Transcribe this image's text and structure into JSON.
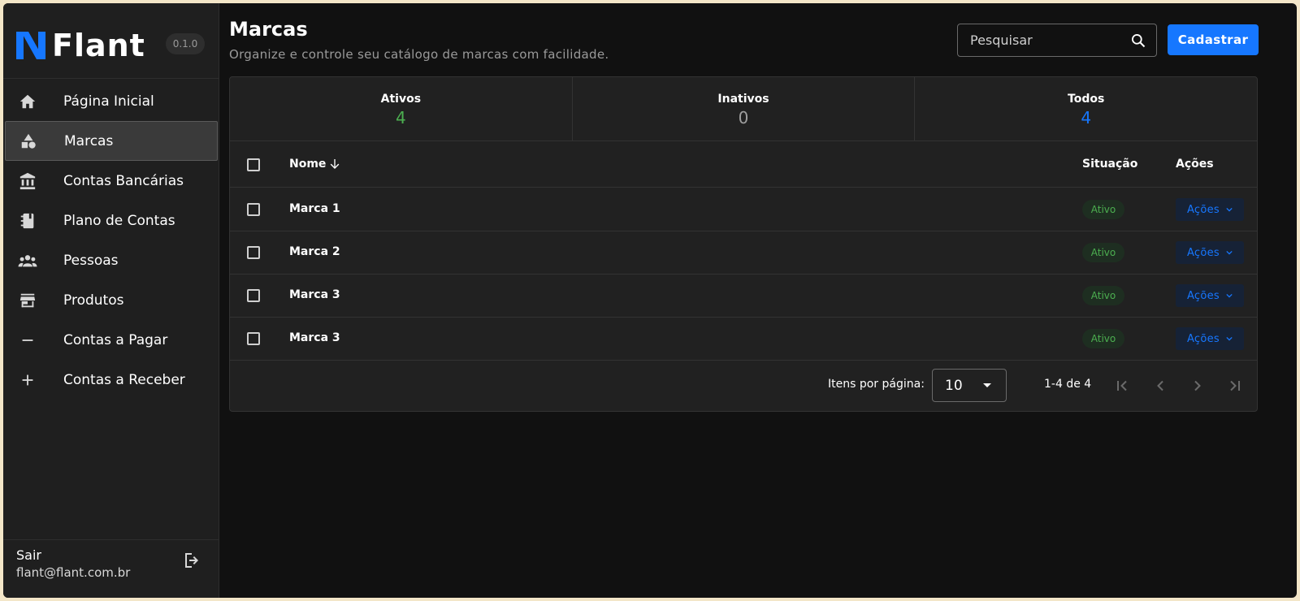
{
  "app": {
    "brand": "Flant",
    "version": "0.1.0"
  },
  "sidebar": {
    "items": [
      {
        "label": "Página Inicial",
        "icon": "home-icon"
      },
      {
        "label": "Marcas",
        "icon": "shapes-icon",
        "active": true
      },
      {
        "label": "Contas Bancárias",
        "icon": "bank-icon"
      },
      {
        "label": "Plano de Contas",
        "icon": "notebook-icon"
      },
      {
        "label": "Pessoas",
        "icon": "people-icon"
      },
      {
        "label": "Produtos",
        "icon": "store-icon"
      },
      {
        "label": "Contas a Pagar",
        "icon": "minus-icon"
      },
      {
        "label": "Contas a Receber",
        "icon": "plus-icon"
      }
    ],
    "logout_label": "Sair",
    "user_email": "flant@flant.com.br"
  },
  "header": {
    "title": "Marcas",
    "subtitle": "Organize e controle seu catálogo de marcas com facilidade.",
    "search_placeholder": "Pesquisar",
    "create_label": "Cadastrar"
  },
  "stats": [
    {
      "label": "Ativos",
      "value": "4",
      "color": "#4caf50"
    },
    {
      "label": "Inativos",
      "value": "0",
      "color": "#9e9e9e"
    },
    {
      "label": "Todos",
      "value": "4",
      "color": "#1677ff"
    }
  ],
  "table": {
    "columns": {
      "name": "Nome",
      "status": "Situação",
      "actions": "Ações"
    },
    "rows": [
      {
        "name": "Marca 1",
        "status": "Ativo",
        "action": "Ações"
      },
      {
        "name": "Marca 2",
        "status": "Ativo",
        "action": "Ações"
      },
      {
        "name": "Marca 3",
        "status": "Ativo",
        "action": "Ações"
      },
      {
        "name": "Marca 3",
        "status": "Ativo",
        "action": "Ações"
      }
    ]
  },
  "pagination": {
    "items_per_page_label": "Itens por página:",
    "items_per_page": "10",
    "range": "1-4 de 4"
  },
  "colors": {
    "accent": "#1677ff",
    "success": "#4caf50",
    "background": "#111111",
    "surface": "#212121"
  }
}
